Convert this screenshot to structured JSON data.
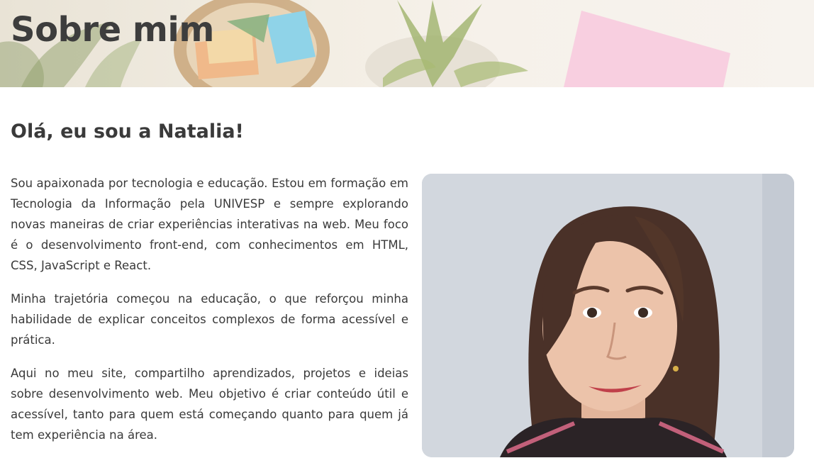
{
  "banner": {
    "title": "Sobre mim"
  },
  "content": {
    "heading": "Olá, eu sou a Natalia!",
    "paragraphs": [
      "Sou apaixonada por tecnologia e educação. Estou em formação em Tecnologia da Informação pela UNIVESP e sempre explorando novas maneiras de criar experiências interativas na web. Meu foco é o desenvolvimento front-end, com conhecimentos em HTML, CSS, JavaScript e React.",
      "Minha trajetória começou na educação, o que reforçou minha habilidade de explicar conceitos complexos de forma acessível e prática.",
      "Aqui no meu site, compartilho aprendizados, projetos e ideias sobre desenvolvimento web. Meu objetivo é criar conteúdo útil e acessível, tanto para quem está começando quanto para quem já tem experiência na área."
    ]
  },
  "colors": {
    "text": "#3a3a3a",
    "banner_background": "#f3eee4",
    "photo_background": "#cdd3db"
  },
  "icons": {
    "profile_photo": "profile-photo"
  }
}
